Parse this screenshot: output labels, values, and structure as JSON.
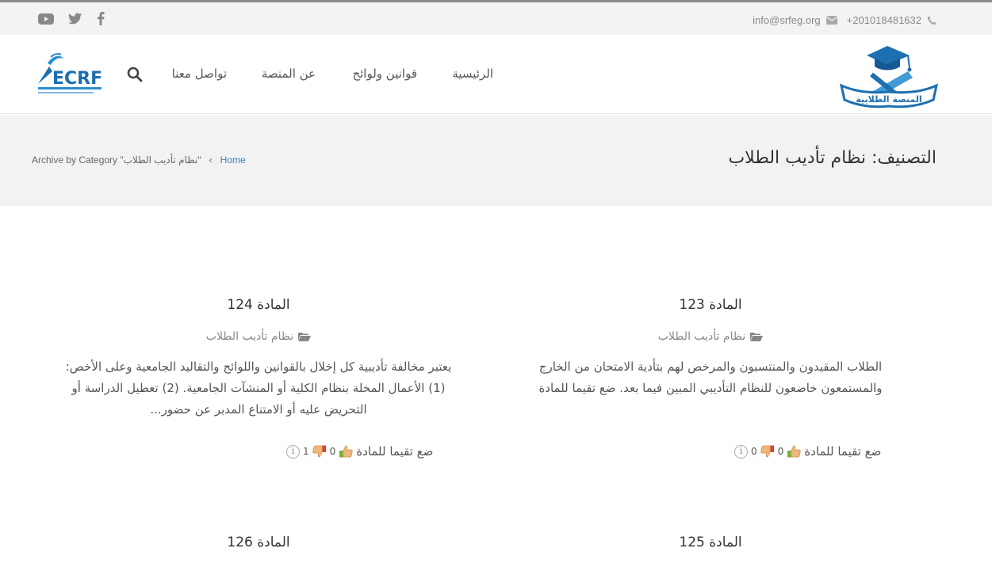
{
  "topbar": {
    "email": "info@srfeg.org",
    "phone": "+201018481632",
    "social": [
      "youtube-icon",
      "twitter-icon",
      "facebook-icon"
    ]
  },
  "header": {
    "logo_text": "ECRF",
    "nav": [
      "الرئيسية",
      "قوانين ولوائح",
      "عن المنصة",
      "تواصل معنا"
    ],
    "site_logo_text": "المنصة الطلابية"
  },
  "banner": {
    "title": "التصنيف: نظام تأديب الطلاب",
    "breadcrumb_home": "Home",
    "breadcrumb_current": "Archive by Category \"نظام تأديب الطلاب\""
  },
  "posts": [
    {
      "title": "المادة 123",
      "category": "نظام تأديب الطلاب",
      "excerpt": "الطلاب المقيدون والمنتسبون والمرخص لهم بتأدية الامتحان من الخارج والمستمعون خاضعون للنظام التأديبي المبين فيما بعد. ضع تقيما للمادة",
      "rating_label": "ضع تقيما للمادة",
      "likes": "0",
      "dislikes": "0"
    },
    {
      "title": "المادة 124",
      "category": "نظام تأديب الطلاب",
      "excerpt": "يعتبر مخالفة تأديبية كل إخلال بالقوانين واللوائح والتقاليد الجامعية وعلى الأخص: (1) الأعمال المخلة بنظام الكلية أو المنشآت الجامعية. (2) تعطيل الدراسة أو التحريض عليه أو الامتناع المدبر عن حضور...",
      "rating_label": "ضع تقيما للمادة",
      "likes": "0",
      "dislikes": "1"
    },
    {
      "title": "المادة 125"
    },
    {
      "title": "المادة 126"
    }
  ],
  "colors": {
    "topbar_bg": "#f3f3f3",
    "banner_bg": "#f2f2f2",
    "link": "#3b7fc4",
    "text": "#333333"
  }
}
